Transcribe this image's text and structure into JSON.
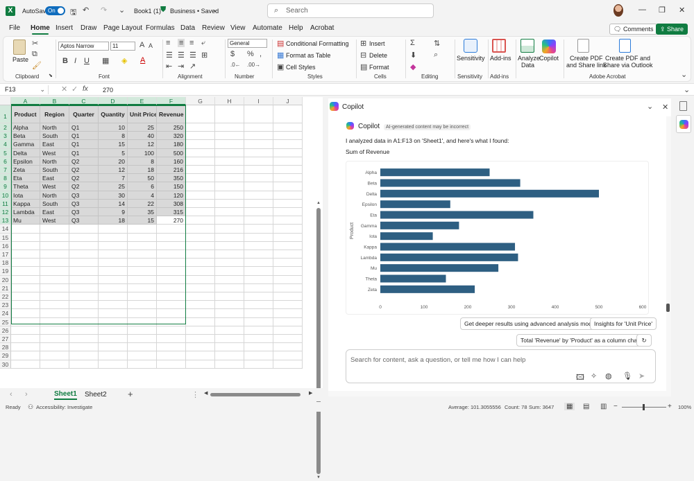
{
  "titlebar": {
    "autosave_label": "AutoSave",
    "autosave_state": "On",
    "title": "Book1 (1)",
    "sensitivity": "Business • Saved",
    "search_placeholder": "Search",
    "dropdown_glyph": "⌄"
  },
  "menubar": {
    "items": [
      "File",
      "Home",
      "Insert",
      "Draw",
      "Page Layout",
      "Formulas",
      "Data",
      "Review",
      "View",
      "Automate",
      "Help",
      "Acrobat"
    ],
    "active": "Home",
    "comments_label": "Comments",
    "share_label": "Share"
  },
  "ribbon": {
    "paste_label": "Paste",
    "font_name": "Aptos Narrow",
    "font_size": "11",
    "number_format": "General",
    "conditional_formatting": "Conditional Formatting",
    "format_as_table": "Format as Table",
    "cell_styles": "Cell Styles",
    "insert": "Insert",
    "delete": "Delete",
    "format": "Format",
    "sensitivity": "Sensitivity",
    "addins": "Add-ins",
    "analyze_data_1": "Analyze",
    "analyze_data_2": "Data",
    "copilot": "Copilot",
    "create_pdf_1": "Create PDF",
    "create_pdf_2": "and Share link",
    "create_pdf_outlook_1": "Create PDF and",
    "create_pdf_outlook_2": "Share via Outlook",
    "groups": {
      "clipboard": "Clipboard",
      "font": "Font",
      "alignment": "Alignment",
      "number": "Number",
      "styles": "Styles",
      "cells": "Cells",
      "editing": "Editing",
      "sensitivity": "Sensitivity",
      "addins": "Add-ins",
      "acrobat": "Adobe Acrobat"
    }
  },
  "formulabar": {
    "namebox": "F13",
    "fx": "fx",
    "value": "270"
  },
  "sheet": {
    "columns": [
      "A",
      "B",
      "C",
      "D",
      "E",
      "F",
      "G",
      "H",
      "I",
      "J"
    ],
    "headers": [
      "Product",
      "Region",
      "Quarter",
      "Quantity",
      "Unit Price",
      "Revenue"
    ],
    "rows": [
      [
        "Alpha",
        "North",
        "Q1",
        "10",
        "25",
        "250"
      ],
      [
        "Beta",
        "South",
        "Q1",
        "8",
        "40",
        "320"
      ],
      [
        "Gamma",
        "East",
        "Q1",
        "15",
        "12",
        "180"
      ],
      [
        "Delta",
        "West",
        "Q1",
        "5",
        "100",
        "500"
      ],
      [
        "Epsilon",
        "North",
        "Q2",
        "20",
        "8",
        "160"
      ],
      [
        "Zeta",
        "South",
        "Q2",
        "12",
        "18",
        "216"
      ],
      [
        "Eta",
        "East",
        "Q2",
        "7",
        "50",
        "350"
      ],
      [
        "Theta",
        "West",
        "Q2",
        "25",
        "6",
        "150"
      ],
      [
        "Iota",
        "North",
        "Q3",
        "30",
        "4",
        "120"
      ],
      [
        "Kappa",
        "South",
        "Q3",
        "14",
        "22",
        "308"
      ],
      [
        "Lambda",
        "East",
        "Q3",
        "9",
        "35",
        "315"
      ],
      [
        "Mu",
        "West",
        "Q3",
        "18",
        "15",
        "270"
      ]
    ],
    "row_numbers": [
      "1",
      "2",
      "3",
      "4",
      "5",
      "6",
      "7",
      "8",
      "9",
      "10",
      "11",
      "12",
      "13",
      "14",
      "15",
      "16",
      "17",
      "18",
      "19",
      "20",
      "21",
      "22",
      "23",
      "24",
      "25",
      "26",
      "27",
      "28",
      "29",
      "30"
    ],
    "tabs": [
      "Sheet1",
      "Sheet2"
    ],
    "active_tab": "Sheet1"
  },
  "statusbar": {
    "ready": "Ready",
    "accessibility": "Accessibility: Investigate",
    "average": "Average: 101.3055556",
    "count": "Count: 78",
    "sum": "Sum: 3647",
    "zoom": "100%"
  },
  "copilot": {
    "pane_title": "Copilot",
    "msg_title": "Copilot",
    "badge": "AI-generated content may be incorrect",
    "message": "I analyzed data in A1:F13 on 'Sheet1', and here's what I found:",
    "chart_caption": "Sum of Revenue",
    "suggestions": [
      "Get deeper results using advanced analysis mode",
      "Insights for 'Unit Price'",
      "Total 'Revenue' by 'Product' as a column chart"
    ],
    "ask_placeholder": "Search for content, ask a question, or tell me how I can help"
  },
  "chart_data": {
    "type": "bar",
    "orientation": "horizontal",
    "title": "Sum of Revenue",
    "ylabel": "Product",
    "xlabel": "",
    "categories": [
      "Alpha",
      "Beta",
      "Delta",
      "Epsilon",
      "Eta",
      "Gamma",
      "Iota",
      "Kappa",
      "Lambda",
      "Mu",
      "Theta",
      "Zeta"
    ],
    "values": [
      250,
      320,
      500,
      160,
      350,
      180,
      120,
      308,
      315,
      270,
      150,
      216
    ],
    "xlim": [
      0,
      600
    ],
    "xticks": [
      0,
      100,
      200,
      300,
      400,
      500,
      600
    ],
    "bar_color": "#2e5f82",
    "grid": false
  },
  "colors": {
    "accent": "#107c41",
    "selection": "#d9d9d9"
  }
}
